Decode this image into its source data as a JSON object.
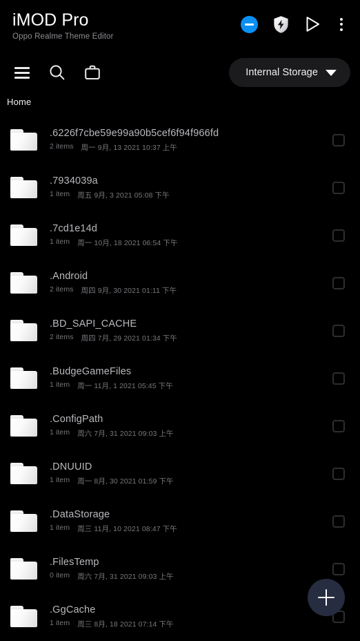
{
  "app": {
    "title": "iMOD Pro",
    "subtitle": "Oppo Realme Theme Editor"
  },
  "header": {
    "icons": [
      {
        "name": "minus-circle-icon",
        "color": "#0a90f5"
      },
      {
        "name": "shield-bolt-icon",
        "color": "#e9e9ec"
      },
      {
        "name": "play-icon",
        "color": "#ffffff"
      },
      {
        "name": "overflow-menu-icon",
        "color": "#e8e8ea"
      }
    ]
  },
  "toolbar": {
    "list_view_label": "list-view",
    "search_label": "search",
    "briefcase_label": "briefcase",
    "storage_label": "Internal Storage"
  },
  "breadcrumb": {
    "current": "Home"
  },
  "colors": {
    "background": "#000000",
    "accent_blue": "#0a90f5",
    "fab": "#272d40",
    "pill": "#1b1b1d",
    "filename": "#b9b9be",
    "meta": "#78787e"
  },
  "files": [
    {
      "name": ".6226f7cbe59e99a90b5cef6f94f966fd",
      "count": "2 items",
      "date": "周一 9月, 13 2021 10:37 上午",
      "checked": false
    },
    {
      "name": ".7934039a",
      "count": "1 item",
      "date": "周五 9月, 3 2021 05:08 下午",
      "checked": false
    },
    {
      "name": ".7cd1e14d",
      "count": "1 item",
      "date": "周一 10月, 18 2021 06:54 下午",
      "checked": false
    },
    {
      "name": ".Android",
      "count": "2 items",
      "date": "周四 9月, 30 2021 01:11 下午",
      "checked": false
    },
    {
      "name": ".BD_SAPI_CACHE",
      "count": "2 items",
      "date": "周四 7月, 29 2021 01:34 下午",
      "checked": false
    },
    {
      "name": ".BudgeGameFiles",
      "count": "1 item",
      "date": "周一 11月, 1 2021 05:45 下午",
      "checked": false
    },
    {
      "name": ".ConfigPath",
      "count": "1 item",
      "date": "周六 7月, 31 2021 09:03 上午",
      "checked": false
    },
    {
      "name": ".DNUUID",
      "count": "1 item",
      "date": "周一 8月, 30 2021 01:59 下午",
      "checked": false
    },
    {
      "name": ".DataStorage",
      "count": "1 item",
      "date": "周三 11月, 10 2021 08:47 下午",
      "checked": false
    },
    {
      "name": ".FilesTemp",
      "count": "0 item",
      "date": "周六 7月, 31 2021 09:03 上午",
      "checked": false
    },
    {
      "name": ".GgCache",
      "count": "1 item",
      "date": "周三 8月, 18 2021 07:14 下午",
      "checked": false
    }
  ],
  "fab": {
    "label": "add"
  }
}
